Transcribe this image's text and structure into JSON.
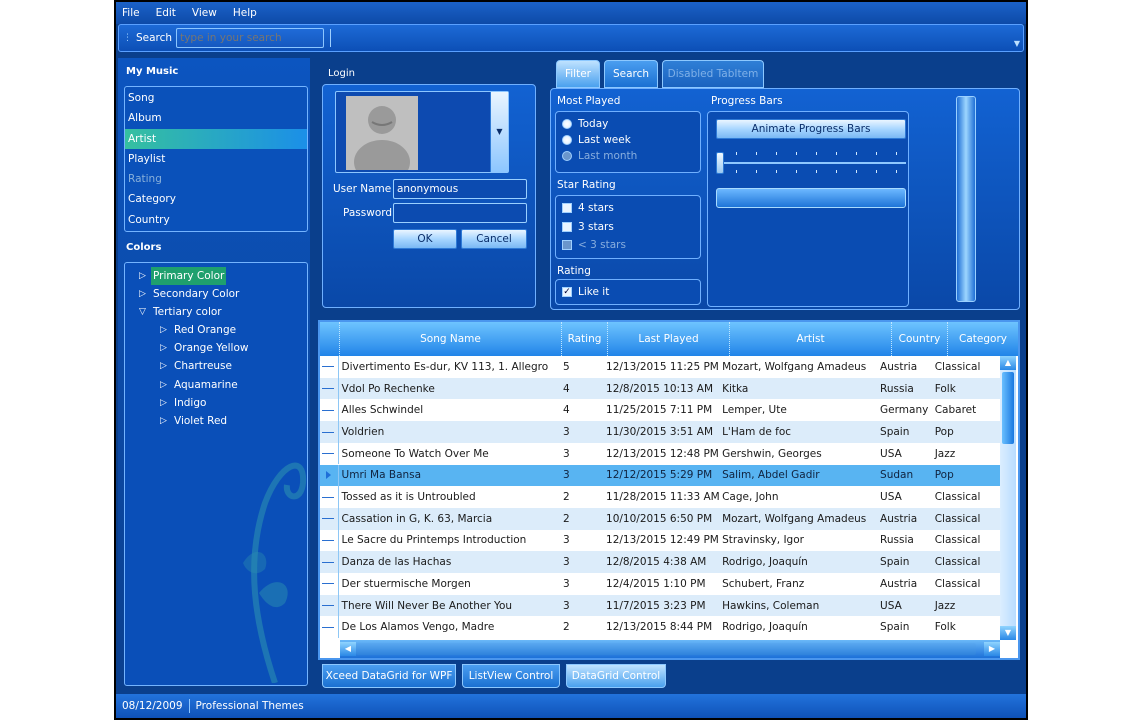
{
  "menu": [
    "File",
    "Edit",
    "View",
    "Help"
  ],
  "search": {
    "label": "Search",
    "placeholder": "type in your search"
  },
  "sidebar": {
    "my_music_title": "My Music",
    "items": [
      {
        "label": "Song",
        "state": "normal"
      },
      {
        "label": "Album",
        "state": "normal"
      },
      {
        "label": "Artist",
        "state": "selected"
      },
      {
        "label": "Playlist",
        "state": "normal"
      },
      {
        "label": "Rating",
        "state": "disabled"
      },
      {
        "label": "Category",
        "state": "normal"
      },
      {
        "label": "Country",
        "state": "normal"
      }
    ],
    "colors_title": "Colors",
    "tree": [
      {
        "label": "Primary Color",
        "level": 0,
        "expanded": false,
        "selected": true
      },
      {
        "label": "Secondary Color",
        "level": 0,
        "expanded": false,
        "selected": false
      },
      {
        "label": "Tertiary color",
        "level": 0,
        "expanded": true,
        "selected": false
      },
      {
        "label": "Red Orange",
        "level": 1,
        "expanded": false,
        "selected": false
      },
      {
        "label": "Orange Yellow",
        "level": 1,
        "expanded": false,
        "selected": false
      },
      {
        "label": "Chartreuse",
        "level": 1,
        "expanded": false,
        "selected": false
      },
      {
        "label": "Aquamarine",
        "level": 1,
        "expanded": false,
        "selected": false
      },
      {
        "label": "Indigo",
        "level": 1,
        "expanded": false,
        "selected": false
      },
      {
        "label": "Violet Red",
        "level": 1,
        "expanded": false,
        "selected": false
      }
    ]
  },
  "login": {
    "title": "Login",
    "username_label": "User Name",
    "username_value": "anonymous",
    "password_label": "Password",
    "password_value": "",
    "ok_label": "OK",
    "cancel_label": "Cancel"
  },
  "tabs": [
    {
      "label": "Filter",
      "state": "active"
    },
    {
      "label": "Search",
      "state": "normal"
    },
    {
      "label": "Disabled TabItem",
      "state": "disabled"
    }
  ],
  "filter": {
    "most_played_title": "Most Played",
    "most_played": [
      {
        "label": "Today",
        "disabled": false
      },
      {
        "label": "Last week",
        "disabled": false
      },
      {
        "label": "Last month",
        "disabled": true
      }
    ],
    "star_rating_title": "Star Rating",
    "star_rating": [
      {
        "label": "4 stars",
        "checked": false,
        "disabled": false
      },
      {
        "label": "3 stars",
        "checked": false,
        "disabled": false
      },
      {
        "label": "< 3 stars",
        "checked": false,
        "disabled": true
      }
    ],
    "rating_title": "Rating",
    "like_it_label": "Like it",
    "like_it_checked": true,
    "progress_title": "Progress Bars",
    "animate_label": "Animate Progress Bars"
  },
  "grid": {
    "columns": [
      "Song Name",
      "Rating",
      "Last Played",
      "Artist",
      "Country",
      "Category"
    ],
    "selected_row": 5,
    "rows": [
      [
        "Divertimento Es-dur, KV 113, 1. Allegro",
        "5",
        "12/13/2015 11:25 PM",
        "Mozart, Wolfgang Amadeus",
        "Austria",
        "Classical"
      ],
      [
        "Vdol Po Rechenke",
        "4",
        "12/8/2015 10:13 AM",
        "Kitka",
        "Russia",
        "Folk"
      ],
      [
        "Alles Schwindel",
        "4",
        "11/25/2015 7:11 PM",
        "Lemper, Ute",
        "Germany",
        "Cabaret"
      ],
      [
        "Voldrien",
        "3",
        "11/30/2015 3:51 AM",
        "L'Ham de foc",
        "Spain",
        "Pop"
      ],
      [
        "Someone To Watch Over Me",
        "3",
        "12/13/2015 12:48 PM",
        "Gershwin, Georges",
        "USA",
        "Jazz"
      ],
      [
        "Umri Ma Bansa",
        "3",
        "12/12/2015 5:29 PM",
        "Salim, Abdel Gadir",
        "Sudan",
        "Pop"
      ],
      [
        "Tossed as it is Untroubled",
        "2",
        "11/28/2015 11:33 AM",
        "Cage, John",
        "USA",
        "Classical"
      ],
      [
        "Cassation in G, K. 63, Marcia",
        "2",
        "10/10/2015 6:50 PM",
        "Mozart, Wolfgang Amadeus",
        "Austria",
        "Classical"
      ],
      [
        "Le Sacre du Printemps Introduction",
        "3",
        "12/13/2015 12:49 PM",
        "Stravinsky, Igor",
        "Russia",
        "Classical"
      ],
      [
        "Danza de las Hachas",
        "3",
        "12/8/2015 4:38 AM",
        "Rodrigo, Joaquín",
        "Spain",
        "Classical"
      ],
      [
        "Der stuermische Morgen",
        "3",
        "12/4/2015 1:10 PM",
        "Schubert, Franz",
        "Austria",
        "Classical"
      ],
      [
        "There Will Never Be Another You",
        "3",
        "11/7/2015 3:23 PM",
        "Hawkins, Coleman",
        "USA",
        "Jazz"
      ],
      [
        "De Los Alamos Vengo, Madre",
        "2",
        "12/13/2015 8:44 PM",
        "Rodrigo, Joaquín",
        "Spain",
        "Folk"
      ]
    ]
  },
  "bottom_tabs": [
    {
      "label": "Xceed DataGrid for WPF",
      "state": "normal"
    },
    {
      "label": "ListView Control",
      "state": "normal"
    },
    {
      "label": "DataGrid Control",
      "state": "active"
    }
  ],
  "status": {
    "date": "08/12/2009",
    "theme": "Professional Themes"
  }
}
